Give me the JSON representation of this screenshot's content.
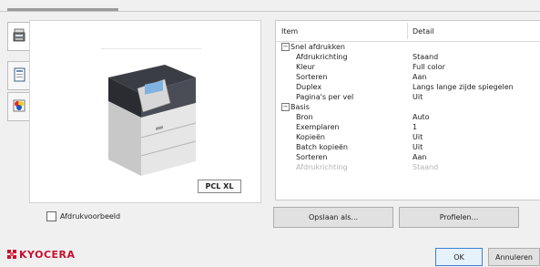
{
  "preview": {
    "pdl_badge": "PCL XL",
    "preview_checkbox_label": "Afdrukvoorbeeld",
    "preview_checked": false
  },
  "table": {
    "headers": {
      "item": "Item",
      "detail": "Detail"
    },
    "groups": [
      {
        "name": "Snel afdrukken",
        "expanded": true,
        "rows": [
          {
            "item": "Afdrukrichting",
            "detail": "Staand"
          },
          {
            "item": "Kleur",
            "detail": "Full color"
          },
          {
            "item": "Sorteren",
            "detail": "Aan"
          },
          {
            "item": "Duplex",
            "detail": "Langs lange zijde spiegelen"
          },
          {
            "item": "Pagina's per vel",
            "detail": "Uit"
          }
        ]
      },
      {
        "name": "Basis",
        "expanded": true,
        "rows": [
          {
            "item": "Bron",
            "detail": "Auto"
          },
          {
            "item": "Exemplaren",
            "detail": "1"
          },
          {
            "item": "Kopieën",
            "detail": "Uit"
          },
          {
            "item": "Batch kopieën",
            "detail": "Uit"
          },
          {
            "item": "Sorteren",
            "detail": "Aan"
          },
          {
            "item": "Afdrukrichting",
            "detail": "Staand"
          }
        ]
      }
    ]
  },
  "buttons": {
    "save_as": "Opslaan als...",
    "profiles": "Profielen...",
    "ok": "OK",
    "cancel": "Annuleren"
  },
  "brand": {
    "name": "KYOCERA",
    "color": "#c8102e"
  },
  "icons": {
    "tab1": "printer-icon",
    "tab2": "document-icon",
    "tab3": "color-icon"
  }
}
